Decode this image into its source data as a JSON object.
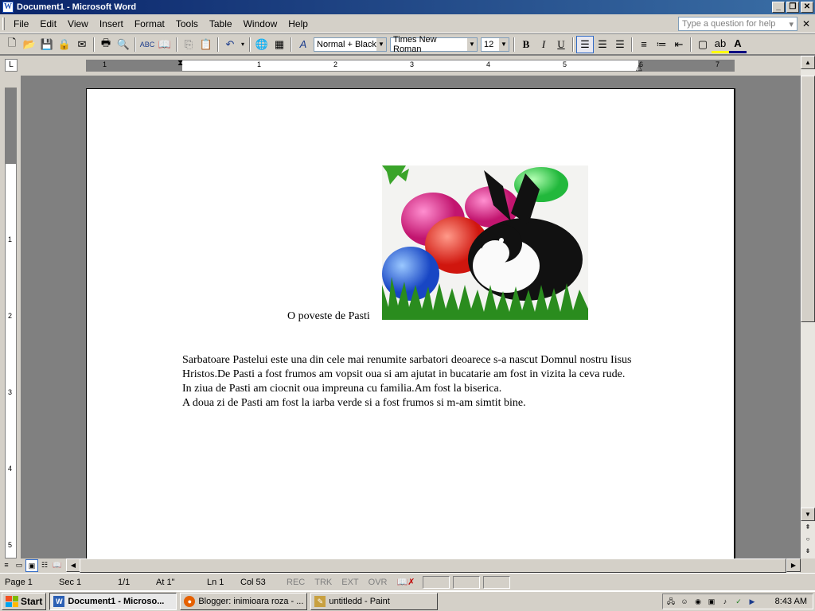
{
  "window": {
    "title": "Document1 - Microsoft Word"
  },
  "menu": {
    "items": [
      "File",
      "Edit",
      "View",
      "Insert",
      "Format",
      "Tools",
      "Table",
      "Window",
      "Help"
    ],
    "help_placeholder": "Type a question for help"
  },
  "toolbar": {
    "style": "Normal + Black",
    "font": "Times New Roman",
    "size": "12",
    "bold": "B",
    "italic": "I",
    "underline": "U"
  },
  "ruler": {
    "h_numbers": [
      "1",
      "1",
      "2",
      "3",
      "4",
      "5",
      "6",
      "7"
    ],
    "v_numbers": [
      "1",
      "2",
      "3",
      "4",
      "5"
    ]
  },
  "document": {
    "caption": "O poveste de Pasti",
    "paragraphs": [
      "Sarbatoare Pastelui este una din cele mai renumite sarbatori deoarece s-a nascut Domnul nostru Iisus Hristos.De Pasti a fost frumos am vopsit oua si am ajutat in bucatarie am fost in vizita la ceva rude.",
      "In ziua de Pasti am ciocnit oua impreuna cu familia.Am fost la biserica.",
      "A doua zi de Pasti am fost la iarba  verde si a fost frumos si m-am simtit bine."
    ]
  },
  "status": {
    "page": "Page  1",
    "sec": "Sec  1",
    "pages": "1/1",
    "at": "At  1\"",
    "ln": "Ln  1",
    "col": "Col  53",
    "rec": "REC",
    "trk": "TRK",
    "ext": "EXT",
    "ovr": "OVR"
  },
  "taskbar": {
    "start": "Start",
    "tasks": [
      {
        "label": "Document1 - Microso...",
        "icon": "word-icon",
        "active": true
      },
      {
        "label": "Blogger: inimioara roza - ...",
        "icon": "firefox-icon",
        "active": false
      },
      {
        "label": "untitledd - Paint",
        "icon": "paint-icon",
        "active": false
      }
    ],
    "clock": "8:43 AM"
  },
  "colors": {
    "title_start": "#0a246a",
    "title_end": "#3a6ea5",
    "face": "#d4d0c8",
    "spell": "#ff0000"
  }
}
